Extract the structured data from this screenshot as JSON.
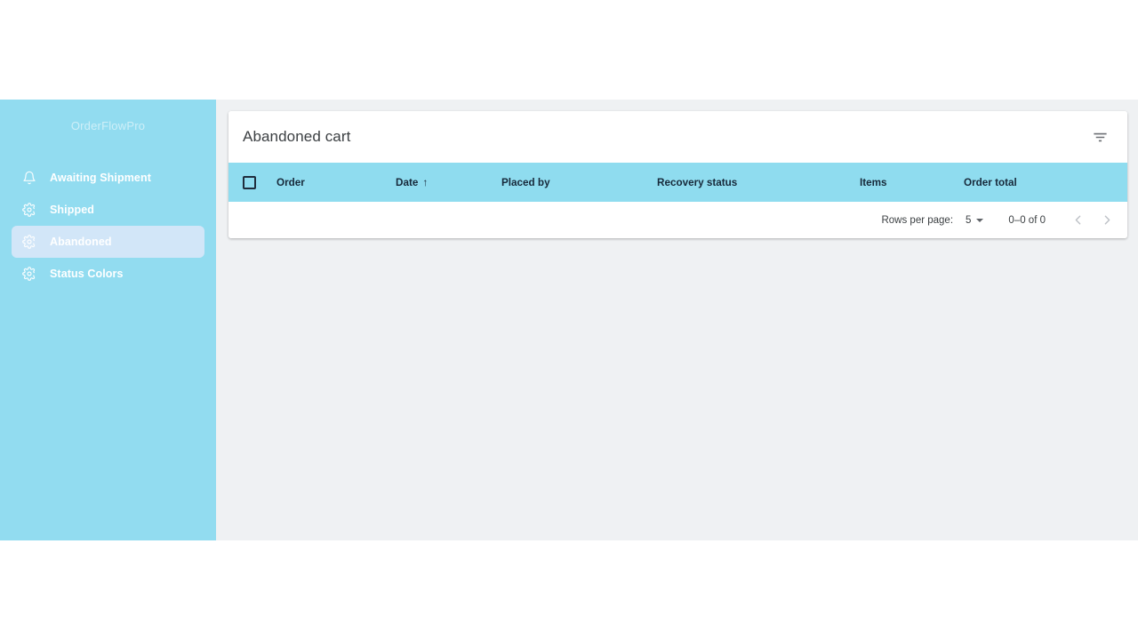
{
  "app": {
    "brand": "OrderFlowPro"
  },
  "sidebar": {
    "items": [
      {
        "label": "Awaiting Shipment",
        "icon": "bell-icon",
        "active": false
      },
      {
        "label": "Shipped",
        "icon": "gear-icon",
        "active": false
      },
      {
        "label": "Abandoned",
        "icon": "gear-icon",
        "active": true
      },
      {
        "label": "Status Colors",
        "icon": "gear-icon",
        "active": false
      }
    ]
  },
  "toolbar": {
    "title": "Abandoned cart",
    "filter_icon": "filter-list-icon"
  },
  "table": {
    "columns": [
      {
        "label": "Order",
        "sorted": false
      },
      {
        "label": "Date",
        "sorted": true,
        "sort_arrow": "↑"
      },
      {
        "label": "Placed by",
        "sorted": false
      },
      {
        "label": "Recovery status",
        "sorted": false
      },
      {
        "label": "Items",
        "sorted": false
      },
      {
        "label": "Order total",
        "sorted": false
      }
    ],
    "rows": []
  },
  "pagination": {
    "rows_per_page_label": "Rows per page:",
    "rows_per_page_value": "5",
    "range_label": "0–0 of 0",
    "prev_label": "‹",
    "next_label": "›"
  },
  "colors": {
    "sidebar_bg": "#92dcf0",
    "header_bg": "#8fdcef",
    "active_item_bg": "#d2e6f8",
    "content_bg": "#eff1f3",
    "card_bg": "#ffffff",
    "header_text": "#17293a"
  }
}
